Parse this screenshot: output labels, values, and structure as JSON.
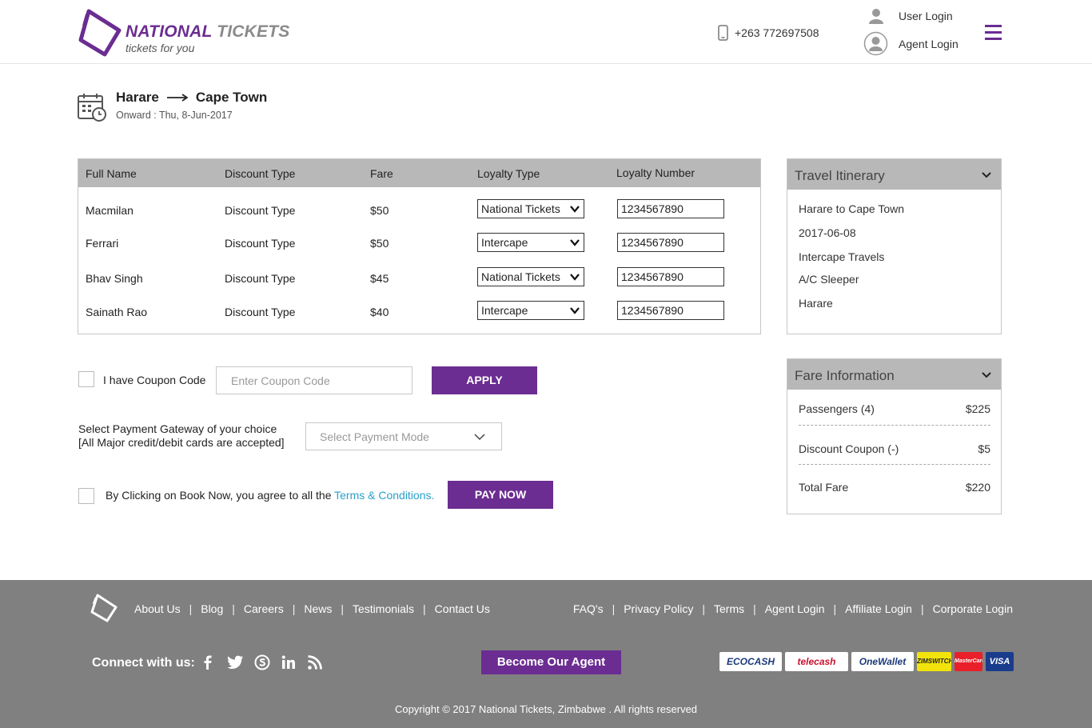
{
  "header": {
    "logo_name_1": "NATIONAL",
    "logo_name_2": "TICKETS",
    "logo_tagline": "tickets for you",
    "phone": "+263 772697508",
    "user_login": "User Login",
    "agent_login": "Agent Login"
  },
  "route": {
    "from": "Harare",
    "to": "Cape Town",
    "onward": "Onward : Thu, 8-Jun-2017"
  },
  "passengers": {
    "columns": [
      "Full Name",
      "Discount Type",
      "Fare",
      "Loyalty Type",
      "Loyalty Number"
    ],
    "rows": [
      {
        "name": "Macmilan",
        "discount": "Discount Type",
        "fare": "$50",
        "loyalty_type": "National Tickets",
        "loyalty_number": "1234567890"
      },
      {
        "name": "Ferrari",
        "discount": "Discount Type",
        "fare": "$50",
        "loyalty_type": "Intercape",
        "loyalty_number": "1234567890"
      },
      {
        "name": "Bhav Singh",
        "discount": "Discount Type",
        "fare": "$45",
        "loyalty_type": "National Tickets",
        "loyalty_number": "1234567890"
      },
      {
        "name": "Sainath Rao",
        "discount": "Discount Type",
        "fare": "$40",
        "loyalty_type": "Intercape",
        "loyalty_number": "1234567890"
      }
    ]
  },
  "coupon": {
    "label": "I have Coupon Code",
    "placeholder": "Enter Coupon Code",
    "apply": "APPLY"
  },
  "payment": {
    "label_line1": "Select Payment Gateway of your choice",
    "label_line2": "[All Major credit/debit cards are accepted]",
    "placeholder": "Select Payment Mode"
  },
  "agreement": {
    "text": "By Clicking on Book Now, you agree to all the ",
    "link": "Terms & Conditions.",
    "pay_now": "PAY NOW"
  },
  "itinerary": {
    "title": "Travel Itinerary",
    "items": [
      "Harare to Cape Town",
      "2017-06-08",
      "Intercape Travels",
      "A/C Sleeper",
      "Harare"
    ]
  },
  "fare_info": {
    "title": "Fare Information",
    "rows": [
      {
        "label": "Passengers (4)",
        "amount": "$225"
      },
      {
        "label": "Discount Coupon (-)",
        "amount": "$5"
      },
      {
        "label": "Total Fare",
        "amount": "$220"
      }
    ]
  },
  "footer": {
    "left_links": [
      "About Us",
      "Blog",
      "Careers",
      "News",
      "Testimonials",
      "Contact Us"
    ],
    "right_links": [
      "FAQ's",
      "Privacy Policy",
      "Terms",
      "Agent Login",
      "Affiliate Login",
      "Corporate Login"
    ],
    "connect": "Connect with us:",
    "become_agent": "Become Our Agent",
    "payment_logos": [
      "ECOCASH",
      "telecash",
      "OneWallet",
      "ZIMSWITCH",
      "MasterCard",
      "VISA"
    ],
    "copyright": "Copyright © 2017 National Tickets, Zimbabwe . All rights reserved"
  },
  "colors": {
    "brand_purple": "#6b2d91",
    "table_header_gray": "#b8b8b8",
    "footer_gray": "#808080",
    "link_blue": "#2aa0c8"
  }
}
